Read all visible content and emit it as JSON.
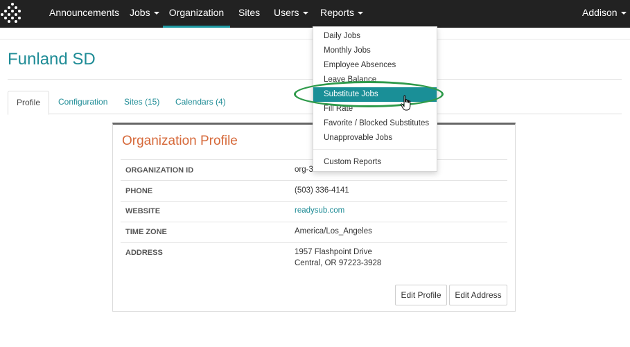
{
  "nav": {
    "items": [
      {
        "label": "Announcements",
        "dropdown": false,
        "active": false
      },
      {
        "label": "Jobs",
        "dropdown": true,
        "active": false
      },
      {
        "label": "Organization",
        "dropdown": false,
        "active": true
      },
      {
        "label": "Sites",
        "dropdown": false,
        "active": false
      },
      {
        "label": "Users",
        "dropdown": true,
        "active": false
      },
      {
        "label": "Reports",
        "dropdown": true,
        "active": false
      }
    ],
    "user": "Addison",
    "logo_icon": "dots-diamond-icon"
  },
  "page": {
    "title": "Funland SD",
    "tabs": [
      "Profile",
      "Configuration",
      "Sites (15)",
      "Calendars (4)"
    ],
    "active_tab": "Profile"
  },
  "profile": {
    "heading": "Organization Profile",
    "rows": [
      {
        "label": "ORGANIZATION ID",
        "value": "org-3..."
      },
      {
        "label": "PHONE",
        "value": "(503) 336-4141"
      },
      {
        "label": "WEBSITE",
        "value": "readysub.com"
      },
      {
        "label": "TIME ZONE",
        "value": "America/Los_Angeles"
      },
      {
        "label": "ADDRESS",
        "value": "1957 Flashpoint Drive",
        "value2": "Central, OR 97223-3928"
      }
    ],
    "buttons": {
      "edit_profile": "Edit Profile",
      "edit_address": "Edit Address"
    }
  },
  "reports_menu": {
    "items": [
      "Daily Jobs",
      "Monthly Jobs",
      "Employee Absences",
      "Leave Balance",
      "Substitute Jobs",
      "Fill Rate",
      "Favorite / Blocked Substitutes",
      "Unapprovable Jobs"
    ],
    "custom": "Custom Reports",
    "highlighted": "Substitute Jobs"
  },
  "colors": {
    "navbar": "#222222",
    "accent": "#1f8c96",
    "highlight": "#1a8f97",
    "card_title": "#d6693a",
    "annotation": "#2e9a4a"
  }
}
